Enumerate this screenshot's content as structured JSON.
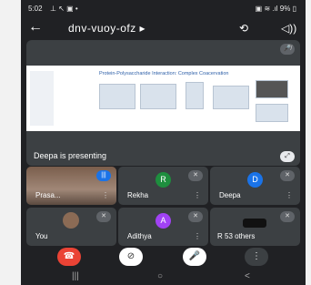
{
  "status": {
    "time": "5:02",
    "left_icons": "⊥ ↖ ▣ •",
    "right": "▣ ≋ .ıl 9% ▯"
  },
  "header": {
    "back_icon": "←",
    "title": "dnv-vuoy-ofz ▸",
    "switch_camera_icon": "⟲",
    "audio_icon": "◁))"
  },
  "presentation": {
    "slide_title": "Protein-Polysaccharide Interaction: Complex Coacervation",
    "caption": "Deepa is presenting",
    "fullscreen_icon": "⤢",
    "muted_icon": "🎤̸"
  },
  "participants": [
    {
      "name": "Prasa...",
      "type": "photo",
      "talking": true
    },
    {
      "name": "Rekha",
      "initial": "R",
      "color": "#1e8e3e"
    },
    {
      "name": "Deepa",
      "initial": "D",
      "color": "#1a73e8"
    },
    {
      "name": "You",
      "type": "photo-small"
    },
    {
      "name": "Adithya",
      "initial": "A",
      "color": "#a142f4"
    },
    {
      "name": "R 53 others",
      "type": "group"
    }
  ],
  "more_icon": "⋮",
  "controls": {
    "end_call_icon": "☎",
    "camera_off_icon": "⊘",
    "mic_off_icon": "🎤",
    "more_icon": "⋮"
  },
  "nav": {
    "recent": "|||",
    "home": "○",
    "back": "<"
  }
}
